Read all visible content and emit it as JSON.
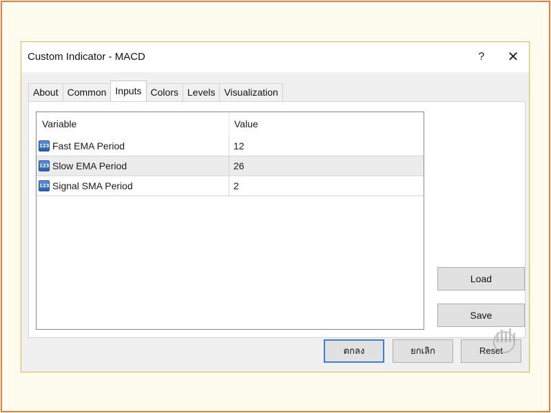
{
  "window": {
    "title": "Custom Indicator - MACD",
    "help_glyph": "?",
    "close_glyph": "✕"
  },
  "tabs": [
    {
      "label": "About"
    },
    {
      "label": "Common"
    },
    {
      "label": "Inputs",
      "active": true
    },
    {
      "label": "Colors"
    },
    {
      "label": "Levels"
    },
    {
      "label": "Visualization"
    }
  ],
  "inputs_table": {
    "columns": [
      "Variable",
      "Value"
    ],
    "rows": [
      {
        "variable": "Fast EMA Period",
        "value": "12",
        "icon": "numeric-123-icon"
      },
      {
        "variable": "Slow EMA Period",
        "value": "26",
        "icon": "numeric-123-icon"
      },
      {
        "variable": "Signal SMA Period",
        "value": "2",
        "icon": "numeric-123-icon"
      }
    ],
    "icon_text": "123"
  },
  "side_buttons": {
    "load": "Load",
    "save": "Save"
  },
  "bottom_buttons": {
    "ok": "ตกลง",
    "cancel": "ยกเลิก",
    "reset": "Reset"
  },
  "colors": {
    "frame_border": "#ef7a3a",
    "dialog_border": "#f0b437",
    "default_button_border": "#3c7fd0",
    "icon_blue": "#2c5fb0"
  }
}
